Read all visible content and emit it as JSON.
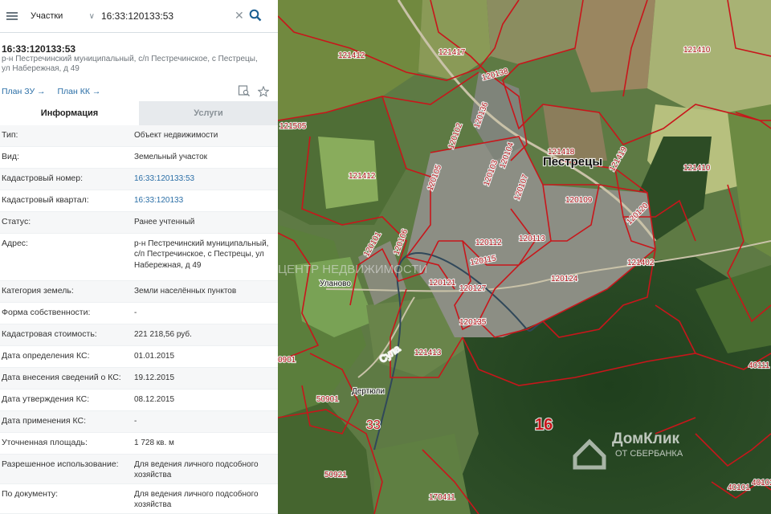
{
  "search": {
    "layer": "Участки",
    "query": "16:33:120133:53"
  },
  "card": {
    "title": "16:33:120133:53",
    "address_line": "р-н Пестречинский муниципальный, с/п Пестречинское, с Пестрецы, ул Набережная, д 49",
    "plan_zu": "План ЗУ →",
    "plan_kk": "План КК →"
  },
  "tabs": [
    {
      "label": "Информация"
    },
    {
      "label": "Услуги"
    }
  ],
  "rows": [
    {
      "label": "Тип:",
      "value": "Объект недвижимости"
    },
    {
      "label": "Вид:",
      "value": "Земельный участок"
    },
    {
      "label": "Кадастровый номер:",
      "value": "16:33:120133:53"
    },
    {
      "label": "Кадастровый квартал:",
      "value": "16:33:120133"
    },
    {
      "label": "Статус:",
      "value": "Ранее учтенный"
    },
    {
      "label": "Адрес:",
      "value": "р-н Пестречинский муниципальный, с/п Пестречинское, с Пестрецы, ул Набережная, д 49"
    },
    {
      "label": "Категория земель:",
      "value": "Земли населённых пунктов"
    },
    {
      "label": "Форма собственности:",
      "value": "-"
    },
    {
      "label": "Кадастровая стоимость:",
      "value": "221 218,56 руб."
    },
    {
      "label": "Дата определения КС:",
      "value": "01.01.2015"
    },
    {
      "label": "Дата внесения сведений о КС:",
      "value": "19.12.2015"
    },
    {
      "label": "Дата утверждения КС:",
      "value": "08.12.2015"
    },
    {
      "label": "Дата применения КС:",
      "value": "-"
    },
    {
      "label": "Уточненная площадь:",
      "value": "1 728 кв. м"
    },
    {
      "label": "Разрешенное использование:",
      "value": "Для ведения личного подсобного хозяйства"
    },
    {
      "label": "По документу:",
      "value": "Для ведения личного подсобного хозяйства"
    }
  ],
  "map": {
    "town": "Пестрецы",
    "villages": [
      "Улaново",
      "Дертюли"
    ],
    "river": "Сула",
    "district_numbers": [
      "16",
      "33"
    ],
    "parcels": [
      "121412",
      "121417",
      "121410",
      "121505",
      "121412",
      "120138",
      "120136",
      "121418",
      "121419",
      "121410",
      "120102",
      "120104",
      "120103",
      "120107",
      "120109",
      "120105",
      "120120",
      "120112",
      "120113",
      "120115",
      "120124",
      "121402",
      "120101",
      "120106",
      "120121",
      "120127",
      "120135",
      "121413",
      "50901",
      "50921",
      "170411",
      "40111",
      "40101",
      "40102",
      "0901"
    ],
    "watermark_center": "ЦЕНТР НЕДВИЖИМОСТИ",
    "watermark_brand": "ДомКлик",
    "watermark_brand_sub": "ОТ СБЕРБАНКА"
  }
}
